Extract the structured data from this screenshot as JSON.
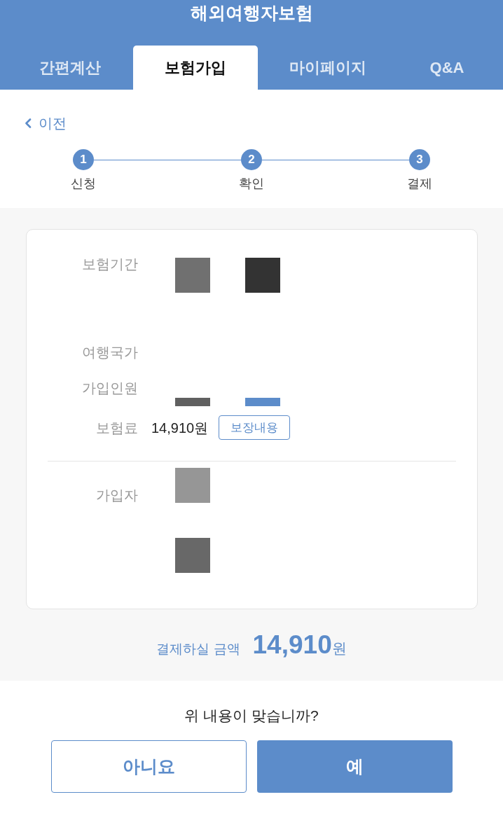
{
  "header": {
    "title": "해외여행자보험"
  },
  "tabs": [
    {
      "label": "간편계산",
      "selected": false
    },
    {
      "label": "보험가입",
      "selected": true
    },
    {
      "label": "마이페이지",
      "selected": false
    },
    {
      "label": "Q&A",
      "selected": false
    }
  ],
  "back_link": {
    "label": "이전"
  },
  "steps": [
    {
      "number": "1",
      "label": "신청"
    },
    {
      "number": "2",
      "label": "확인"
    },
    {
      "number": "3",
      "label": "결제"
    }
  ],
  "summary": {
    "rows": [
      {
        "kind": "squares",
        "label": "보험기간"
      },
      {
        "kind": "empty",
        "label": "여행국가"
      },
      {
        "kind": "bars",
        "label": "가입인원"
      },
      {
        "kind": "price",
        "label": "보험료",
        "value": "14,910원",
        "button": "보장내용"
      }
    ],
    "applicant": {
      "label": "가입자"
    }
  },
  "total": {
    "label": "결제하실 금액",
    "amount": "14,910",
    "unit": "원"
  },
  "confirm": {
    "question": "위 내용이 맞습니까?",
    "buttons": [
      {
        "kind": "secondary",
        "label": "아니요"
      },
      {
        "kind": "primary",
        "label": "예"
      }
    ]
  }
}
